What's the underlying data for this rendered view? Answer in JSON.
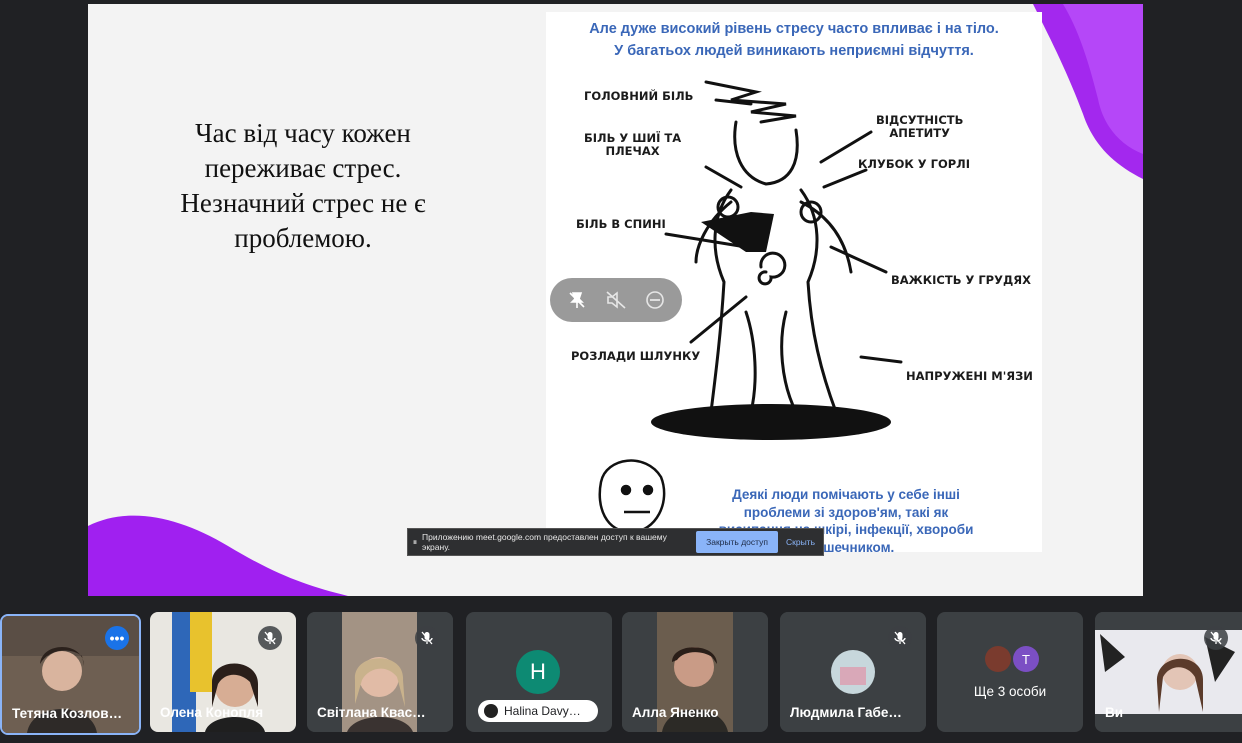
{
  "slide": {
    "left_text": "Час від часу кожен\nпереживає стрес.\nНезначний стрес не є\nпроблемою.",
    "poster_title": "Але дуже високий рівень стресу часто впливає і на тіло.\nУ багатьох людей виникають неприємні відчуття.",
    "labels": {
      "headache": "ГОЛОВНИЙ БІЛЬ",
      "neck": "БІЛЬ У ШИЇ ТА\nПЛЕЧАХ",
      "appetite": "ВІДСУТНІСТЬ\nАПЕТИТУ",
      "throat": "КЛУБОК У ГОРЛІ",
      "back": "БІЛЬ В СПИНІ",
      "chest": "ВАЖКІСТЬ У ГРУДЯХ",
      "stomach": "РОЗЛАДИ ШЛУНКУ",
      "muscles": "НАПРУЖЕНІ М'ЯЗИ"
    },
    "poster_bottom": "Деякі люди помічають у себе інші\nпроблеми зі здоров'ям, такі як\nвисипання на шкірі, інфекції, хвороби\nз кишечником."
  },
  "share_bar": {
    "message": "Приложению meet.google.com предоставлен доступ к вашему экрану.",
    "stop_label": "Закрыть доступ",
    "hide_label": "Скрыть"
  },
  "participants": [
    {
      "name": "Тетяна Козлов…",
      "type": "video",
      "active": true
    },
    {
      "name": "Олена Конопля",
      "type": "video",
      "muted": true
    },
    {
      "name": "Світлана Квас…",
      "type": "video",
      "muted": true
    },
    {
      "name": "Halina Davy…",
      "type": "avatar",
      "initial": "H",
      "color": "#0d8a73"
    },
    {
      "name": "Алла Яненко",
      "type": "video"
    },
    {
      "name": "Людмила Габе…",
      "type": "photo",
      "muted": true
    },
    {
      "name": "Ще 3 особи",
      "type": "group",
      "initial": "T"
    },
    {
      "name": "Ви",
      "type": "video",
      "muted": true
    }
  ],
  "colors": {
    "accent_purple": "#a020f0",
    "poster_blue": "#3a67b8",
    "active_border": "#8ab4f8"
  }
}
